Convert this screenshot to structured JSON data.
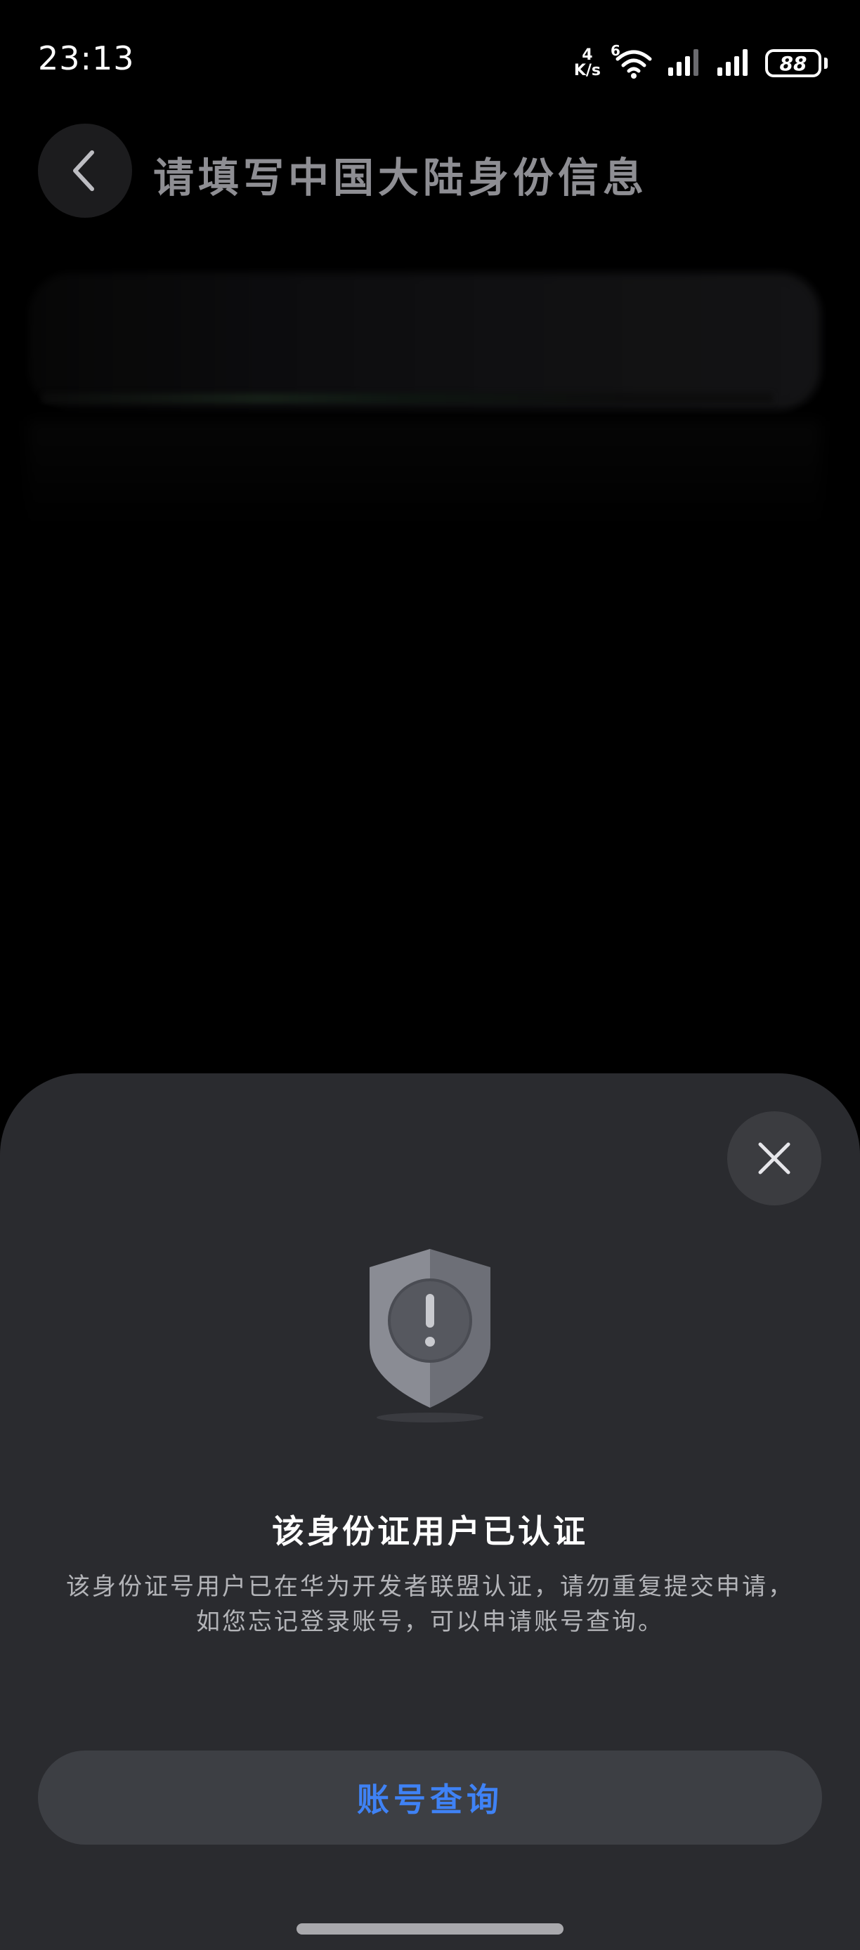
{
  "status_bar": {
    "time": "23:13",
    "net_speed_value": "4",
    "net_speed_unit": "K/s",
    "wifi_badge": "6",
    "battery_level": "88",
    "icons": [
      "wifi-icon",
      "cellular-signal-icon",
      "cellular-signal-icon",
      "battery-icon"
    ]
  },
  "header": {
    "title": "请填写中国大陆身份信息",
    "back_icon": "chevron-left-icon"
  },
  "dialog": {
    "close_icon": "close-icon",
    "status_icon": "shield-exclamation-icon",
    "title": "该身份证用户已认证",
    "description": "该身份证号用户已在华为开发者联盟认证，请勿重复提交申请，如您忘记登录账号，可以申请账号查询。",
    "action_label": "账号查询"
  },
  "colors": {
    "sheet_background": "#2a2b2f",
    "accent": "#3f82f5",
    "button_background": "#3d3f44"
  }
}
